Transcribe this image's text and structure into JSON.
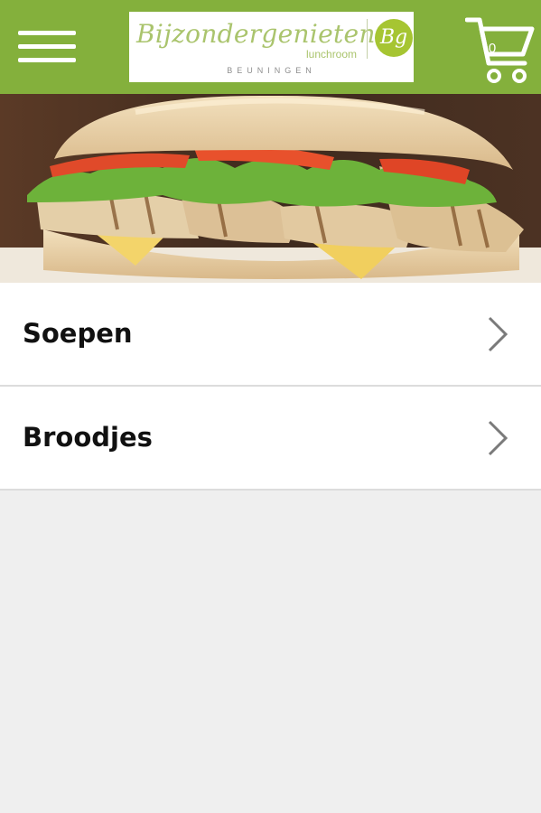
{
  "header": {
    "background_color": "#84b03c",
    "menu_icon": "hamburger-menu-icon",
    "logo": {
      "brand_text": "Bijzondergenieten",
      "sub_text": "lunchroom",
      "monogram": "Bg",
      "city": "BEUNINGEN"
    },
    "cart": {
      "icon": "shopping-cart-icon",
      "count": "0"
    }
  },
  "hero": {
    "image": "sandwich-photo"
  },
  "categories": [
    {
      "label": "Soepen",
      "icon": "chevron-right-icon"
    },
    {
      "label": "Broodjes",
      "icon": "chevron-right-icon"
    }
  ],
  "colors": {
    "accent": "#84b03c",
    "background": "#efefef",
    "divider": "#dcdcdc"
  }
}
